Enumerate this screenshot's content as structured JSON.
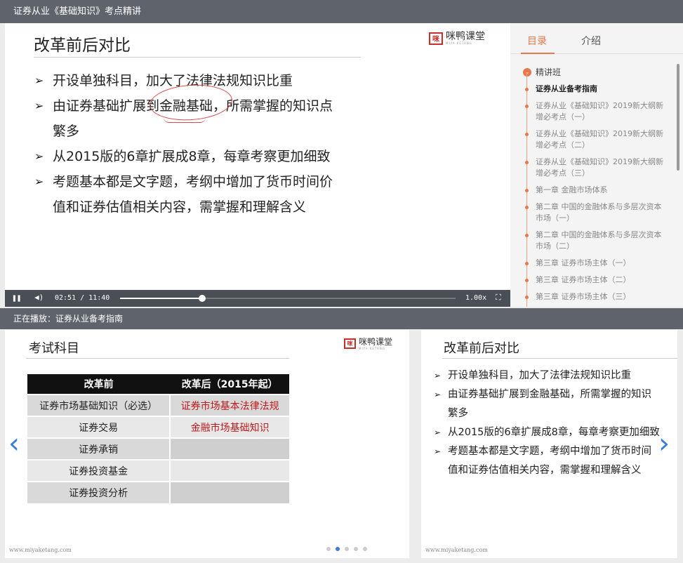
{
  "window": {
    "title": "证券从业《基础知识》考点精讲"
  },
  "slide": {
    "title": "改革前后对比",
    "logo_text": "咪鸭课堂",
    "logo_sub": "MIYA KETANG",
    "bullets": [
      "开设单独科目，加大了法律法规知识比重",
      "由证券基础扩展到金融基础，所需掌握的知识点",
      "繁多",
      "从2015版的6章扩展成8章，每章考察更加细致",
      "考题基本都是文字题，考纲中增加了货币时间价",
      "值和证券估值相关内容，需掌握和理解含义"
    ]
  },
  "controls": {
    "current_time": "02:51",
    "separator": "/",
    "total_time": "11:40",
    "speed": "1.00x",
    "progress": 0.244
  },
  "sidebar": {
    "tabs": [
      "目录",
      "介绍"
    ],
    "chapter": "精讲班",
    "items": [
      "证券从业备考指南",
      "证券从业《基础知识》2019新大纲新增必考点（一）",
      "证券从业《基础知识》2019新大纲新增必考点（二）",
      "证券从业《基础知识》2019新大纲新增必考点（三）",
      "第一章 金融市场体系",
      "第二章 中国的金融体系与多层次资本市场（一）",
      "第二章 中国的金融体系与多层次资本市场（二）",
      "第三章 证券市场主体（一）",
      "第三章 证券市场主体（二）",
      "第三章 证券市场主体（三）"
    ]
  },
  "now_playing": {
    "text": "正在播放：证券从业备考指南"
  },
  "card_left": {
    "title": "考试科目",
    "logo_text": "咪鸭课堂",
    "logo_sub": "MIYA KETANG",
    "table": {
      "headers": [
        "改革前",
        "改革后（2015年起）"
      ],
      "rows": [
        [
          "证券市场基础知识（必选）",
          "证券市场基本法律法规"
        ],
        [
          "证券交易",
          "金融市场基础知识"
        ],
        [
          "证券承销",
          ""
        ],
        [
          "证券投资基金",
          ""
        ],
        [
          "证券投资分析",
          ""
        ]
      ]
    },
    "footer": "www.miyaketang.com"
  },
  "card_right": {
    "title": "改革前后对比",
    "bullets": [
      "开设单独科目，加大了法律法规知识比重",
      "由证券基础扩展到金融基础，所需掌握的知识",
      "繁多",
      "从2015版的6章扩展成8章，每章考察更加细致",
      "考题基本都是文字题，考纲中增加了货币时间",
      "值和证券估值相关内容，需掌握和理解含义"
    ],
    "footer": "www.miyaketang.com"
  },
  "carousel": {
    "page_count": 5,
    "active_index": 1
  },
  "colors": {
    "accent": "#e8774a",
    "nav_blue": "#3a7dd8",
    "annotation_red": "#d64a4a",
    "table_red": "#c0191b"
  }
}
